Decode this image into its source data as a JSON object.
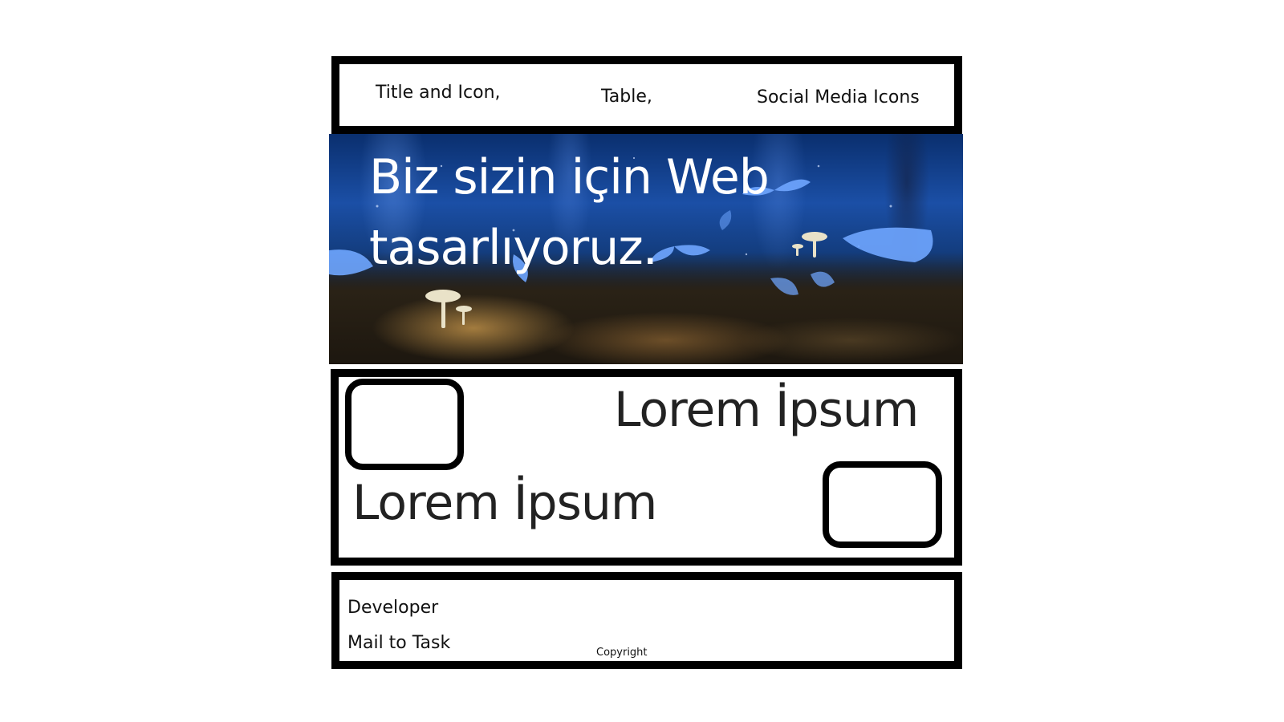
{
  "header": {
    "title_label": "Title and Icon,",
    "table_label": "Table,",
    "social_label": "Social Media Icons"
  },
  "hero": {
    "heading_line1": "Biz sizin için Web",
    "heading_line2": "tasarlıyoruz."
  },
  "content": {
    "lorem_top": "Lorem İpsum",
    "lorem_bottom": "Lorem İpsum"
  },
  "footer": {
    "developer_label": "Developer",
    "mail_label": "Mail to Task",
    "copyright_label": "Copyright"
  }
}
